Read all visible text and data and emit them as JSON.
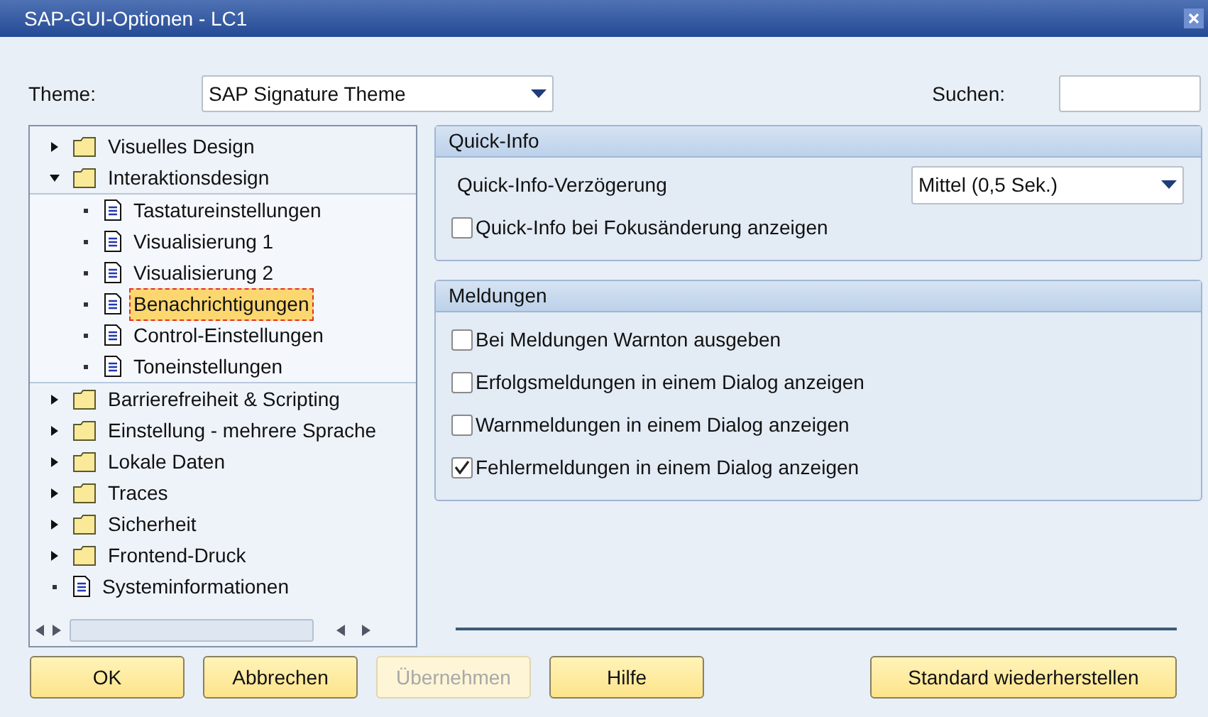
{
  "window": {
    "title": "SAP-GUI-Optionen - LC1"
  },
  "theme": {
    "label": "Theme:",
    "value": "SAP Signature Theme"
  },
  "search": {
    "label": "Suchen:"
  },
  "tree": [
    {
      "label": "Visuelles Design",
      "kind": "folder",
      "expanded": false,
      "selected": false
    },
    {
      "label": "Interaktionsdesign",
      "kind": "folder",
      "expanded": true,
      "selected": false,
      "children": [
        {
          "label": "Tastatureinstellungen",
          "kind": "page",
          "selected": false
        },
        {
          "label": "Visualisierung 1",
          "kind": "page",
          "selected": false
        },
        {
          "label": "Visualisierung 2",
          "kind": "page",
          "selected": false
        },
        {
          "label": "Benachrichtigungen",
          "kind": "page",
          "selected": true
        },
        {
          "label": "Control-Einstellungen",
          "kind": "page",
          "selected": false
        },
        {
          "label": "Toneinstellungen",
          "kind": "page",
          "selected": false
        }
      ]
    },
    {
      "label": "Barrierefreiheit & Scripting",
      "kind": "folder",
      "expanded": false,
      "selected": false
    },
    {
      "label": "Einstellung - mehrere Sprache",
      "kind": "folder",
      "expanded": false,
      "selected": false
    },
    {
      "label": "Lokale Daten",
      "kind": "folder",
      "expanded": false,
      "selected": false
    },
    {
      "label": "Traces",
      "kind": "folder",
      "expanded": false,
      "selected": false
    },
    {
      "label": "Sicherheit",
      "kind": "folder",
      "expanded": false,
      "selected": false
    },
    {
      "label": "Frontend-Druck",
      "kind": "folder",
      "expanded": false,
      "selected": false
    },
    {
      "label": "Systeminformationen",
      "kind": "page",
      "selected": false
    }
  ],
  "groups": [
    {
      "title": "Quick-Info",
      "rows": [
        {
          "kind": "dropdown",
          "label": "Quick-Info-Verzögerung",
          "value": "Mittel (0,5 Sek.)"
        },
        {
          "kind": "checkbox",
          "label": "Quick-Info bei Fokusänderung anzeigen",
          "checked": false
        }
      ]
    },
    {
      "title": "Meldungen",
      "rows": [
        {
          "kind": "checkbox",
          "label": "Bei Meldungen Warnton ausgeben",
          "checked": false
        },
        {
          "kind": "checkbox",
          "label": "Erfolgsmeldungen in einem Dialog anzeigen",
          "checked": false
        },
        {
          "kind": "checkbox",
          "label": "Warnmeldungen in einem Dialog anzeigen",
          "checked": false
        },
        {
          "kind": "checkbox",
          "label": "Fehlermeldungen in einem Dialog anzeigen",
          "checked": true
        }
      ]
    }
  ],
  "buttons": [
    {
      "label": "OK",
      "disabled": false
    },
    {
      "label": "Abbrechen",
      "disabled": false
    },
    {
      "label": "Übernehmen",
      "disabled": true
    },
    {
      "label": "Hilfe",
      "disabled": false
    },
    {
      "label": "Standard wiederherstellen",
      "disabled": false
    }
  ]
}
